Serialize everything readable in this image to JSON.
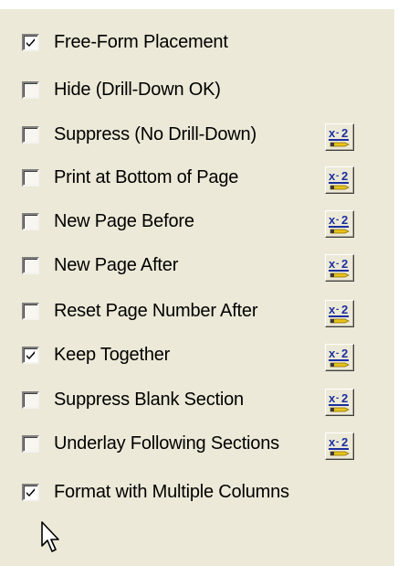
{
  "options": [
    {
      "label": "Free-Form Placement",
      "checked": true,
      "has_formula_button": false
    },
    {
      "label": "Hide (Drill-Down OK)",
      "checked": false,
      "has_formula_button": false
    },
    {
      "label": "Suppress (No Drill-Down)",
      "checked": false,
      "has_formula_button": true
    },
    {
      "label": "Print at Bottom of Page",
      "checked": false,
      "has_formula_button": true
    },
    {
      "label": "New Page Before",
      "checked": false,
      "has_formula_button": true
    },
    {
      "label": "New Page After",
      "checked": false,
      "has_formula_button": true
    },
    {
      "label": "Reset Page Number After",
      "checked": false,
      "has_formula_button": true
    },
    {
      "label": "Keep Together",
      "checked": true,
      "has_formula_button": true
    },
    {
      "label": "Suppress Blank Section",
      "checked": false,
      "has_formula_button": true
    },
    {
      "label": "Underlay Following Sections",
      "checked": false,
      "has_formula_button": true
    },
    {
      "label": "Format with Multiple Columns",
      "checked": true,
      "has_formula_button": false
    }
  ],
  "formula_button": {
    "icon": "formula-x2-pencil-icon"
  },
  "colors": {
    "panel_bg": "#ece9d8",
    "formula_blue": "#1c2f9e",
    "formula_pencil": "#e6c21a"
  }
}
